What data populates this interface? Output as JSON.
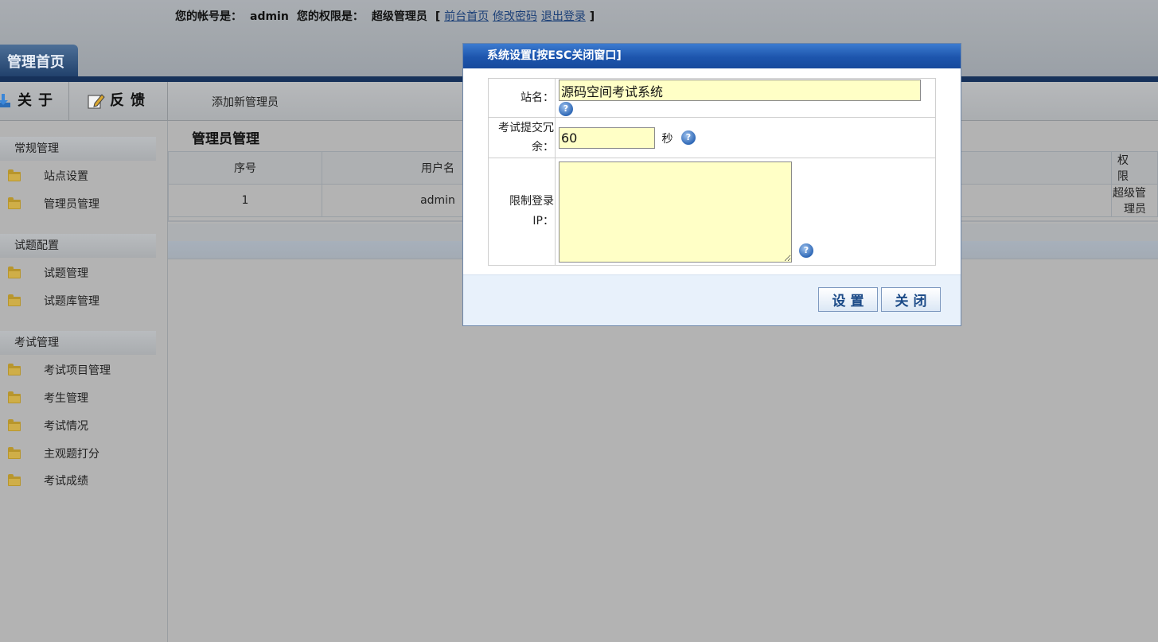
{
  "header": {
    "account_label": "您的帐号是：",
    "account_value": "admin",
    "role_label": "您的权限是：",
    "role_value": "超级管理员",
    "bracket_open": "[",
    "bracket_close": "]",
    "links": [
      "前台首页",
      "修改密码",
      "退出登录"
    ],
    "home_tab": "管理首页"
  },
  "toolbar": {
    "about": "关于",
    "feedback": "反馈",
    "add_admin": "添加新管理员"
  },
  "sidebar": {
    "groups": [
      {
        "title": "常规管理",
        "items": [
          "站点设置",
          "管理员管理"
        ]
      },
      {
        "title": "试题配置",
        "items": [
          "试题管理",
          "试题库管理"
        ]
      },
      {
        "title": "考试管理",
        "items": [
          "考试项目管理",
          "考生管理",
          "考试情况",
          "主观题打分",
          "考试成绩"
        ]
      }
    ]
  },
  "main": {
    "title": "管理员管理",
    "columns": [
      "序号",
      "用户名",
      "",
      "权限"
    ],
    "rows": [
      [
        "1",
        "admin",
        "",
        "超级管理员"
      ]
    ]
  },
  "modal": {
    "title": "系统设置[按ESC关闭窗口]",
    "site_name_label": "站名：",
    "site_name_value": "源码空间考试系统",
    "submit_label": "考试提交冗余：",
    "submit_value": "60",
    "submit_unit": "秒",
    "ip_label": "限制登录IP：",
    "ip_value": "",
    "help_glyph": "?",
    "set_button": "设置",
    "close_button": "关闭"
  },
  "icons": {
    "about": "download-icon",
    "feedback": "edit-icon",
    "folder": "folder-icon",
    "help": "help-icon"
  },
  "colors": {
    "navy": "#16315a",
    "modal_title": "#1d55ad",
    "input_bg": "#ffffc6",
    "link": "#1b3f77"
  }
}
